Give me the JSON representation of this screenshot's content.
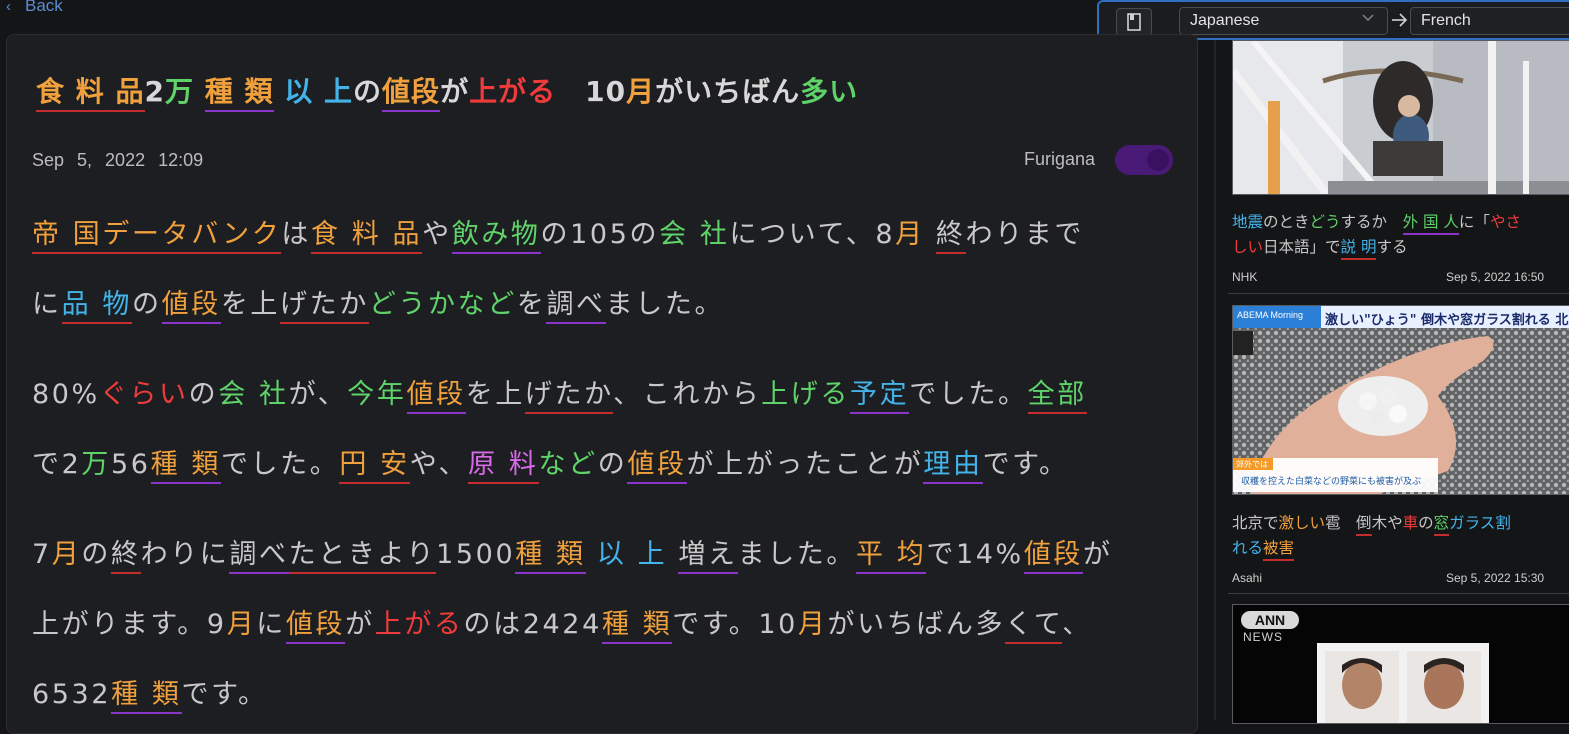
{
  "nav": {
    "back_label": "Back"
  },
  "translate": {
    "from_language": "Japanese",
    "to_language": "French",
    "book_icon": "book-icon",
    "arrow_icon": "arrow-right-icon",
    "dropdown_icon": "chevron-down-icon"
  },
  "article": {
    "title": [
      {
        "t": "食 料 品",
        "c": "o",
        "u": "ur"
      },
      {
        "t": "2",
        "c": "wt",
        "u": ""
      },
      {
        "t": "万",
        "c": "g",
        "u": ""
      },
      {
        "t": " ",
        "c": "wt",
        "u": ""
      },
      {
        "t": "種 類",
        "c": "o",
        "u": "up"
      },
      {
        "t": " ",
        "c": "wt",
        "u": ""
      },
      {
        "t": "以",
        "c": "b",
        "u": ""
      },
      {
        "t": " ",
        "c": "wt",
        "u": ""
      },
      {
        "t": "上",
        "c": "b",
        "u": ""
      },
      {
        "t": "の",
        "c": "wt",
        "u": ""
      },
      {
        "t": "値段",
        "c": "o",
        "u": "up"
      },
      {
        "t": "が",
        "c": "wt",
        "u": ""
      },
      {
        "t": "上がる",
        "c": "r",
        "u": ""
      },
      {
        "t": "　10",
        "c": "wt",
        "u": ""
      },
      {
        "t": "月",
        "c": "o",
        "u": ""
      },
      {
        "t": "がいちばん",
        "c": "wt",
        "u": ""
      },
      {
        "t": "多い",
        "c": "g",
        "u": ""
      }
    ],
    "date": "Sep 5, 2022 12:09",
    "furigana_label": "Furigana",
    "furigana_enabled": true,
    "lines": [
      [
        {
          "t": "帝 国",
          "c": "o",
          "u": "ur"
        },
        {
          "t": "データバンク",
          "c": "o",
          "u": "ur"
        },
        {
          "t": "は",
          "c": "w",
          "u": ""
        },
        {
          "t": "食 料 品",
          "c": "o",
          "u": "ur"
        },
        {
          "t": "や",
          "c": "w",
          "u": ""
        },
        {
          "t": "飲み物",
          "c": "g",
          "u": "up"
        },
        {
          "t": "の105の",
          "c": "w",
          "u": ""
        },
        {
          "t": "会 社",
          "c": "g",
          "u": ""
        },
        {
          "t": "について、8",
          "c": "w",
          "u": ""
        },
        {
          "t": "月",
          "c": "o",
          "u": ""
        },
        {
          "t": " ",
          "c": "w",
          "u": ""
        },
        {
          "t": "終",
          "c": "w",
          "u": "ur"
        },
        {
          "t": "わりまで",
          "c": "w",
          "u": ""
        }
      ],
      [
        {
          "t": "に",
          "c": "w",
          "u": ""
        },
        {
          "t": "品 物",
          "c": "b",
          "u": "ur"
        },
        {
          "t": "の",
          "c": "w",
          "u": ""
        },
        {
          "t": "値段",
          "c": "o",
          "u": "up"
        },
        {
          "t": "を上",
          "c": "w",
          "u": ""
        },
        {
          "t": "げたか",
          "c": "w",
          "u": "ur"
        },
        {
          "t": "どうか",
          "c": "g",
          "u": ""
        },
        {
          "t": "など",
          "c": "g",
          "u": ""
        },
        {
          "t": "を",
          "c": "w",
          "u": ""
        },
        {
          "t": "調べ",
          "c": "w",
          "u": "up"
        },
        {
          "t": "ました。",
          "c": "w",
          "u": ""
        }
      ],
      [
        {
          "t": "80%",
          "c": "w",
          "u": ""
        },
        {
          "t": "ぐらい",
          "c": "r",
          "u": ""
        },
        {
          "t": "の",
          "c": "w",
          "u": ""
        },
        {
          "t": "会 社",
          "c": "g",
          "u": ""
        },
        {
          "t": "が、",
          "c": "w",
          "u": ""
        },
        {
          "t": "今年",
          "c": "g",
          "u": ""
        },
        {
          "t": "値段",
          "c": "o",
          "u": "up"
        },
        {
          "t": "を上",
          "c": "w",
          "u": ""
        },
        {
          "t": "げたか",
          "c": "w",
          "u": "ur"
        },
        {
          "t": "、これから",
          "c": "w",
          "u": ""
        },
        {
          "t": "上げる",
          "c": "g",
          "u": ""
        },
        {
          "t": "予定",
          "c": "b",
          "u": "up"
        },
        {
          "t": "でした。",
          "c": "w",
          "u": ""
        },
        {
          "t": "全部",
          "c": "g",
          "u": "ur"
        }
      ],
      [
        {
          "t": "で2",
          "c": "w",
          "u": ""
        },
        {
          "t": "万",
          "c": "g",
          "u": ""
        },
        {
          "t": "56",
          "c": "w",
          "u": ""
        },
        {
          "t": "種 類",
          "c": "o",
          "u": "up"
        },
        {
          "t": "でした。",
          "c": "w",
          "u": ""
        },
        {
          "t": "円 安",
          "c": "o",
          "u": "ur"
        },
        {
          "t": "や、",
          "c": "w",
          "u": ""
        },
        {
          "t": "原 料",
          "c": "p",
          "u": "ur"
        },
        {
          "t": "など",
          "c": "g",
          "u": ""
        },
        {
          "t": "の",
          "c": "w",
          "u": ""
        },
        {
          "t": "値段",
          "c": "o",
          "u": "up"
        },
        {
          "t": "が上がったことが",
          "c": "w",
          "u": ""
        },
        {
          "t": "理由",
          "c": "b",
          "u": "up"
        },
        {
          "t": "です。",
          "c": "w",
          "u": ""
        }
      ],
      [
        {
          "t": "7",
          "c": "w",
          "u": ""
        },
        {
          "t": "月",
          "c": "o",
          "u": ""
        },
        {
          "t": "の",
          "c": "w",
          "u": ""
        },
        {
          "t": "終",
          "c": "w",
          "u": "ur"
        },
        {
          "t": "わりに",
          "c": "w",
          "u": ""
        },
        {
          "t": "調べ",
          "c": "w",
          "u": "up"
        },
        {
          "t": "たとき",
          "c": "w",
          "u": "ur"
        },
        {
          "t": "より",
          "c": "w",
          "u": "ur"
        },
        {
          "t": "1500",
          "c": "w",
          "u": ""
        },
        {
          "t": "種 類",
          "c": "o",
          "u": "up"
        },
        {
          "t": " ",
          "c": "w",
          "u": ""
        },
        {
          "t": "以 上",
          "c": "b",
          "u": ""
        },
        {
          "t": " ",
          "c": "w",
          "u": ""
        },
        {
          "t": "増え",
          "c": "w",
          "u": "up"
        },
        {
          "t": "ました。",
          "c": "w",
          "u": ""
        },
        {
          "t": "平 均",
          "c": "o",
          "u": "up"
        },
        {
          "t": "で14%",
          "c": "w",
          "u": ""
        },
        {
          "t": "値段",
          "c": "o",
          "u": "up"
        },
        {
          "t": "が",
          "c": "w",
          "u": ""
        }
      ],
      [
        {
          "t": "上がります。9",
          "c": "w",
          "u": ""
        },
        {
          "t": "月",
          "c": "o",
          "u": ""
        },
        {
          "t": "に",
          "c": "w",
          "u": ""
        },
        {
          "t": "値段",
          "c": "o",
          "u": "up"
        },
        {
          "t": "が",
          "c": "w",
          "u": ""
        },
        {
          "t": "上がる",
          "c": "r",
          "u": ""
        },
        {
          "t": "のは2424",
          "c": "w",
          "u": ""
        },
        {
          "t": "種 類",
          "c": "o",
          "u": "up"
        },
        {
          "t": "です。10",
          "c": "w",
          "u": ""
        },
        {
          "t": "月",
          "c": "o",
          "u": ""
        },
        {
          "t": "がいちばん多",
          "c": "w",
          "u": ""
        },
        {
          "t": "くて",
          "c": "w",
          "u": "ur"
        },
        {
          "t": "、",
          "c": "w",
          "u": ""
        }
      ],
      [
        {
          "t": "6532",
          "c": "w",
          "u": ""
        },
        {
          "t": "種 類",
          "c": "o",
          "u": "up"
        },
        {
          "t": "です。",
          "c": "w",
          "u": ""
        }
      ]
    ]
  },
  "sidebar": {
    "news": [
      {
        "title_segments": [
          {
            "t": "地震",
            "c": "b",
            "u": ""
          },
          {
            "t": "のとき",
            "c": "w",
            "u": ""
          },
          {
            "t": "どう",
            "c": "g",
            "u": ""
          },
          {
            "t": "するか　",
            "c": "w",
            "u": ""
          },
          {
            "t": "外 国 人",
            "c": "g",
            "u": "up"
          },
          {
            "t": "に「",
            "c": "w",
            "u": ""
          },
          {
            "t": "やさ",
            "c": "r",
            "u": ""
          }
        ],
        "title_segments_2": [
          {
            "t": "しい",
            "c": "r",
            "u": ""
          },
          {
            "t": "日本語」で",
            "c": "w",
            "u": ""
          },
          {
            "t": "説 明",
            "c": "b",
            "u": "ur"
          },
          {
            "t": "する",
            "c": "w",
            "u": ""
          }
        ],
        "source": "NHK",
        "time": "Sep 5, 2022 16:50"
      },
      {
        "banner_program": "ABEMA Morning",
        "banner_headline": "激しい\"ひょう\" 倒木や窓ガラス割れる 北京",
        "caption_small": "郊外では",
        "caption": "収穫を控えた白菜などの野菜にも被害が及ぶ",
        "title_segments": [
          {
            "t": "北京で",
            "c": "w",
            "u": ""
          },
          {
            "t": "激しい",
            "c": "o",
            "u": ""
          },
          {
            "t": "雹　",
            "c": "w",
            "u": ""
          },
          {
            "t": "倒",
            "c": "w",
            "u": "ur"
          },
          {
            "t": "木や",
            "c": "w",
            "u": ""
          },
          {
            "t": "車",
            "c": "r",
            "u": ""
          },
          {
            "t": "の",
            "c": "w",
            "u": ""
          },
          {
            "t": "窓",
            "c": "g",
            "u": "ur"
          },
          {
            "t": "ガラス割",
            "c": "b",
            "u": ""
          }
        ],
        "title_segments_2": [
          {
            "t": "れる",
            "c": "b",
            "u": ""
          },
          {
            "t": "被害",
            "c": "o",
            "u": "ur"
          }
        ],
        "source": "Asahi",
        "time": "Sep 5, 2022 15:30"
      },
      {
        "logo": "ANN",
        "logo_sub": "NEWS"
      }
    ]
  }
}
